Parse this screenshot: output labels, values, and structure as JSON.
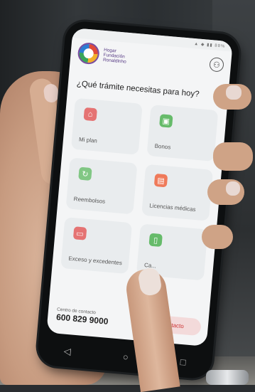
{
  "colors": {
    "brand_purple": "#5a3e87",
    "accent_red": "#cc3333"
  },
  "phone": {
    "status_text": "▲ ◆ ▮▮ 88%",
    "brand_lines": [
      "Hogar",
      "Fundación",
      "Ronaldinho"
    ],
    "question": "¿Qué trámite necesitas para hoy?",
    "tiles": [
      {
        "label": "Mi plan",
        "icon": "home-icon",
        "color": "#e57373"
      },
      {
        "label": "Bonos",
        "icon": "gift-icon",
        "color": "#66bb6a"
      },
      {
        "label": "Reembolsos",
        "icon": "refresh-icon",
        "color": "#81c784"
      },
      {
        "label": "Licencias médicas",
        "icon": "document-icon",
        "color": "#ef7a5a"
      },
      {
        "label": "Exceso y excedentes",
        "icon": "folder-icon",
        "color": "#e57373"
      },
      {
        "label": "Ca...",
        "icon": "card-icon",
        "color": "#66bb6a"
      }
    ],
    "contact": {
      "caption": "Centro de contacto",
      "number": "600 829 9000",
      "button": "Contacto"
    },
    "nav": {
      "back": "◁",
      "home": "○",
      "recent": "□"
    }
  }
}
